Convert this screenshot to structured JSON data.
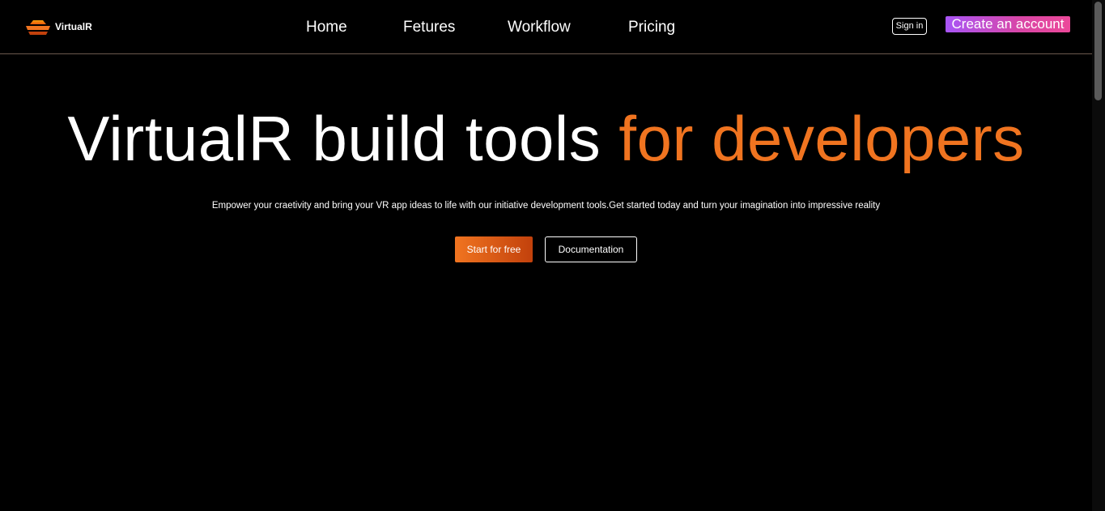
{
  "brand": {
    "name": "VirtualR",
    "logo_icon": "stacked-layers-logo-icon"
  },
  "nav": {
    "items": [
      {
        "label": "Home"
      },
      {
        "label": "Fetures"
      },
      {
        "label": "Workflow"
      },
      {
        "label": "Pricing"
      }
    ],
    "signin_label": "Sign in",
    "create_account_label": "Create an account"
  },
  "hero": {
    "title_main": "VirtualR build tools ",
    "title_accent": "for developers",
    "subtitle": "Empower your craetivity and bring your VR app ideas to life with our initiative development tools.Get started today and turn your imagination into impressive reality",
    "primary_cta": "Start for free",
    "secondary_cta": "Documentation"
  },
  "colors": {
    "background": "#000000",
    "accent_orange": "#f07420",
    "accent_orange_dark": "#c2410c",
    "accent_purple": "#a855f7",
    "accent_pink": "#ec4899",
    "text": "#ffffff"
  }
}
